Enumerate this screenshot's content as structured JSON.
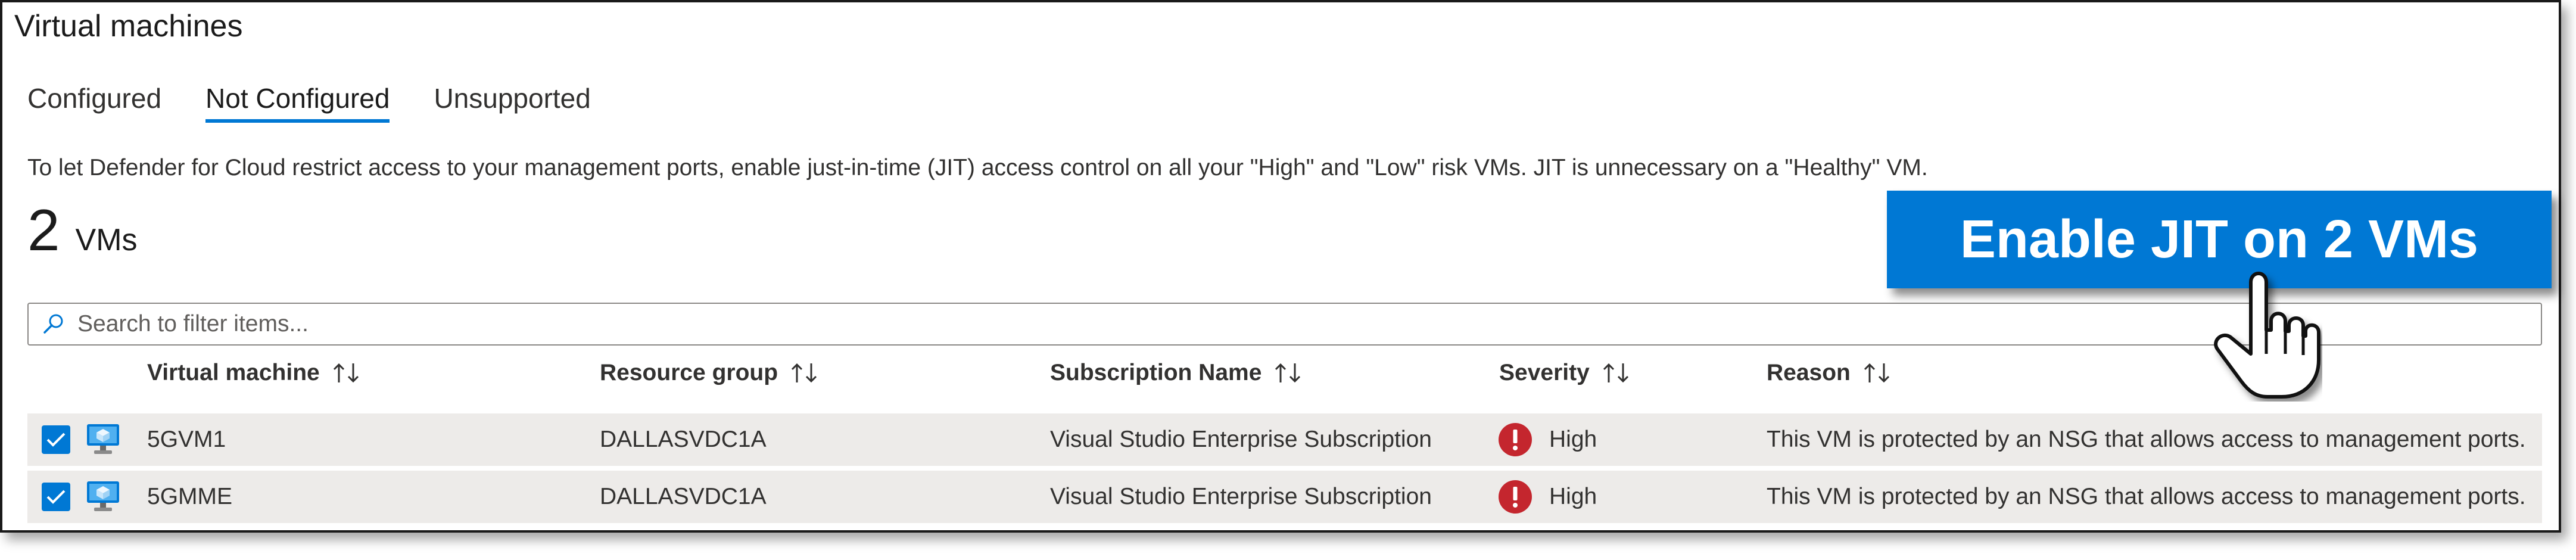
{
  "page": {
    "title": "Virtual machines"
  },
  "tabs": [
    {
      "label": "Configured",
      "active": false
    },
    {
      "label": "Not Configured",
      "active": true
    },
    {
      "label": "Unsupported",
      "active": false
    }
  ],
  "info_text": "To let Defender for Cloud restrict access to your management ports, enable just-in-time (JIT) access control on all your \"High\" and \"Low\" risk VMs. JIT is unnecessary on a \"Healthy\" VM.",
  "vm_count": {
    "number": "2",
    "unit": "VMs"
  },
  "action_button": {
    "label": "Enable JIT on 2 VMs",
    "color": "#0078d4"
  },
  "search": {
    "placeholder": "Search to filter items...",
    "value": ""
  },
  "table": {
    "columns": [
      "Virtual machine",
      "Resource group",
      "Subscription Name",
      "Severity",
      "Reason"
    ],
    "rows": [
      {
        "selected": true,
        "vm": "5GVM1",
        "resource_group": "DALLASVDC1A",
        "subscription": "Visual Studio Enterprise Subscription",
        "severity": "High",
        "reason": "This VM is protected by an NSG that allows access to management ports."
      },
      {
        "selected": true,
        "vm": "5GMME",
        "resource_group": "DALLASVDC1A",
        "subscription": "Visual Studio Enterprise Subscription",
        "severity": "High",
        "reason": "This VM is protected by an NSG that allows access to management ports."
      }
    ]
  },
  "colors": {
    "accent": "#0078d4",
    "severity_high": "#c4262e",
    "row_bg": "#edebe9"
  },
  "icons": {
    "search": "search-icon",
    "vm": "virtual-machine-icon",
    "severity": "error-icon",
    "sort": "sort-icon",
    "cursor": "hand-pointer-icon"
  }
}
